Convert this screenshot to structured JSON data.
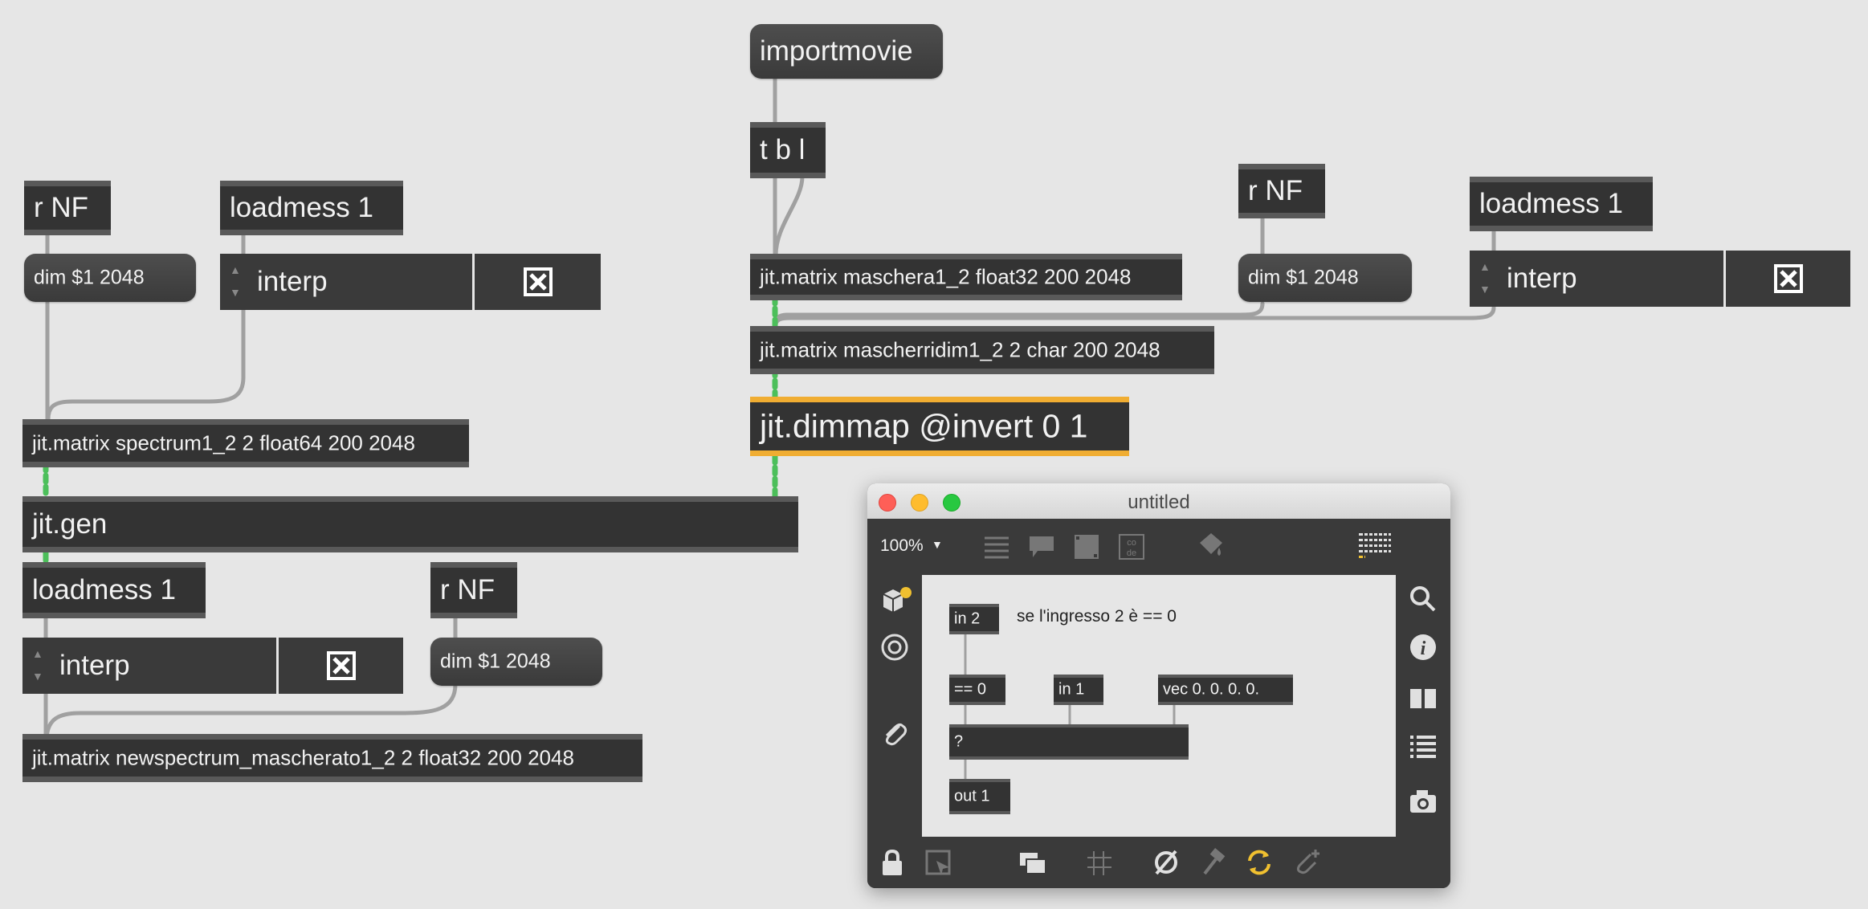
{
  "patch": {
    "objects": {
      "importmovie": "importmovie",
      "tbl": "t b l",
      "rnf_left": "r NF",
      "loadmess_left": "loadmess 1",
      "dim_left": "dim $1 2048",
      "interp_left": "interp",
      "spectrum": "jit.matrix spectrum1_2 2 float64 200 2048",
      "jitgen": "jit.gen",
      "loadmess_bottom": "loadmess 1",
      "rnf_bottom": "r NF",
      "interp_bottom": "interp",
      "dim_bottom": "dim $1 2048",
      "newspectrum": "jit.matrix newspectrum_mascherato1_2 2 float32 200 2048",
      "maschera": "jit.matrix maschera1_2 float32 200 2048",
      "mascherridim": "jit.matrix mascherridim1_2 2 char 200 2048",
      "dimmap": "jit.dimmap @invert 0 1",
      "rnf_right": "r NF",
      "dim_right": "dim $1 2048",
      "loadmess_right": "loadmess 1",
      "interp_right": "interp"
    }
  },
  "window": {
    "title": "untitled",
    "zoom": "100%",
    "subpatch": {
      "in2": "in 2",
      "comment": "se l'ingresso 2 è == 0",
      "eq0": "== 0",
      "in1": "in 1",
      "vec": "vec 0. 0. 0. 0.",
      "q": "?",
      "out1": "out 1"
    }
  },
  "colors": {
    "canvas": "#e6e6e6",
    "object": "#333333",
    "highlight": "#f0ad32",
    "cable": "#a5a5a5",
    "matrix_cable": "#4cbf5a",
    "inlet": "#f08080",
    "outlet": "#e6d36a"
  }
}
